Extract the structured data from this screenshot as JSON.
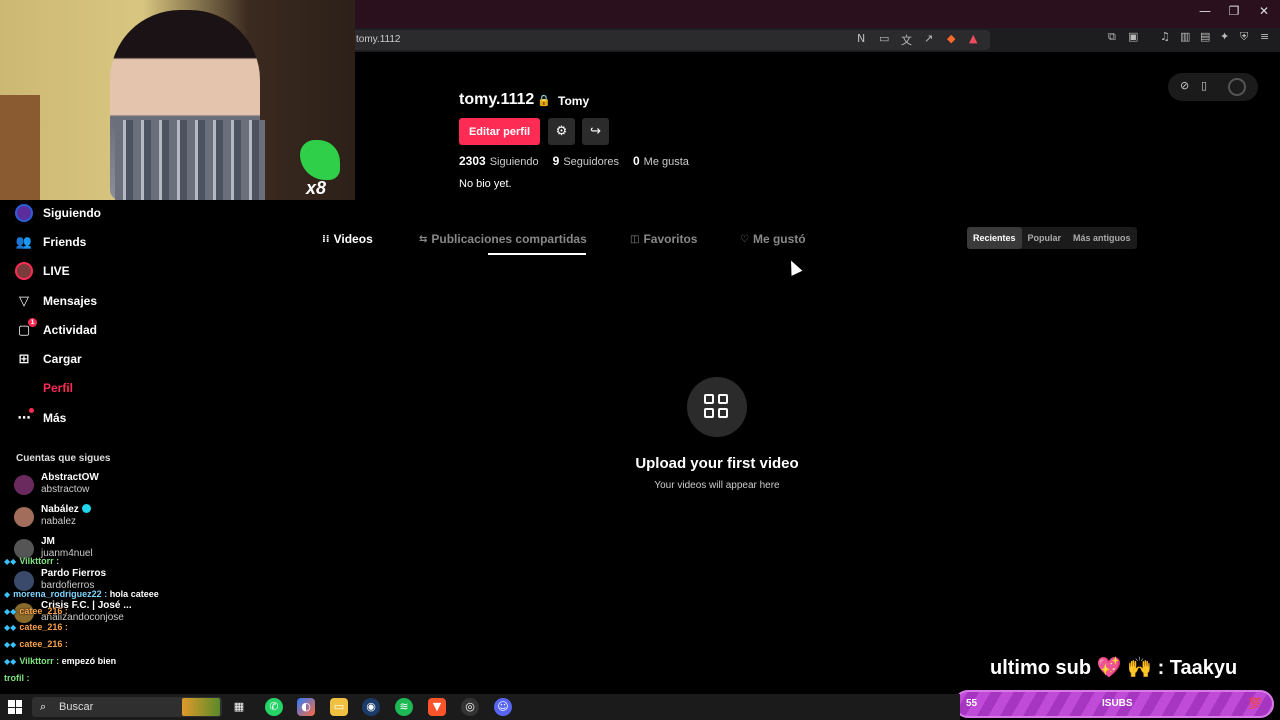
{
  "browser": {
    "url": "tomy.1112",
    "window_controls": [
      "—",
      "❐",
      "✕"
    ]
  },
  "sidebar": {
    "items": [
      {
        "label": "Siguiendo",
        "icon": "following-icon"
      },
      {
        "label": "Friends",
        "icon": "friends-icon"
      },
      {
        "label": "LIVE",
        "icon": "live-icon"
      },
      {
        "label": "Mensajes",
        "icon": "messages-icon"
      },
      {
        "label": "Actividad",
        "icon": "activity-icon",
        "badge": "1"
      },
      {
        "label": "Cargar",
        "icon": "upload-icon"
      },
      {
        "label": "Perfil",
        "icon": "profile-icon"
      },
      {
        "label": "Más",
        "icon": "more-icon"
      }
    ],
    "following_title": "Cuentas que sigues",
    "accounts": [
      {
        "name": "AbstractOW",
        "user": "abstractow"
      },
      {
        "name": "Nabález",
        "user": "nabalez",
        "verified": true
      },
      {
        "name": "JM",
        "user": "juanm4nuel"
      },
      {
        "name": "Pardo Fierros",
        "user": "bardofierros"
      },
      {
        "name": "Crisis F.C. | José ...",
        "user": "analizandoconjose"
      }
    ]
  },
  "chat": [
    {
      "user": "Vilkttorr :",
      "msg": ""
    },
    {
      "user": "morena_rodriguez22 :",
      "msg": " hola cateee"
    },
    {
      "user": "catee_216 :",
      "msg": ""
    },
    {
      "user": "catee_216 :",
      "msg": ""
    },
    {
      "user": "catee_216 :",
      "msg": ""
    },
    {
      "user": "Vilkttorr :",
      "msg": " empezó bien"
    },
    {
      "user": "trofil :",
      "msg": ""
    }
  ],
  "profile": {
    "username": "tomy.1112",
    "nickname": "Tomy",
    "edit_label": "Editar perfil",
    "following_count": "2303",
    "following_label": "Siguiendo",
    "followers_count": "9",
    "followers_label": "Seguidores",
    "likes_count": "0",
    "likes_label": "Me gusta",
    "bio": "No bio yet."
  },
  "tabs": [
    {
      "label": "Videos",
      "icon": "grid-icon"
    },
    {
      "label": "Publicaciones compartidas",
      "icon": "repost-icon"
    },
    {
      "label": "Favoritos",
      "icon": "bookmark-icon"
    },
    {
      "label": "Me gustó",
      "icon": "heart-icon"
    }
  ],
  "sort": {
    "options": [
      "Recientes",
      "Popular",
      "Más antiguos"
    ],
    "selected": "Recientes"
  },
  "empty_state": {
    "title": "Upload your first video",
    "subtitle": "Your videos will appear here"
  },
  "overlay": {
    "sub_text": "ultimo sub 💖 🙌 : Taakyu",
    "bar_left": "55",
    "bar_mid": "ISUBS",
    "bar_right": "💯"
  },
  "taskbar": {
    "search_placeholder": "Buscar"
  },
  "colors": {
    "accent": "#fe2c55",
    "background": "#000000",
    "sub_bar": "#b040cc"
  }
}
